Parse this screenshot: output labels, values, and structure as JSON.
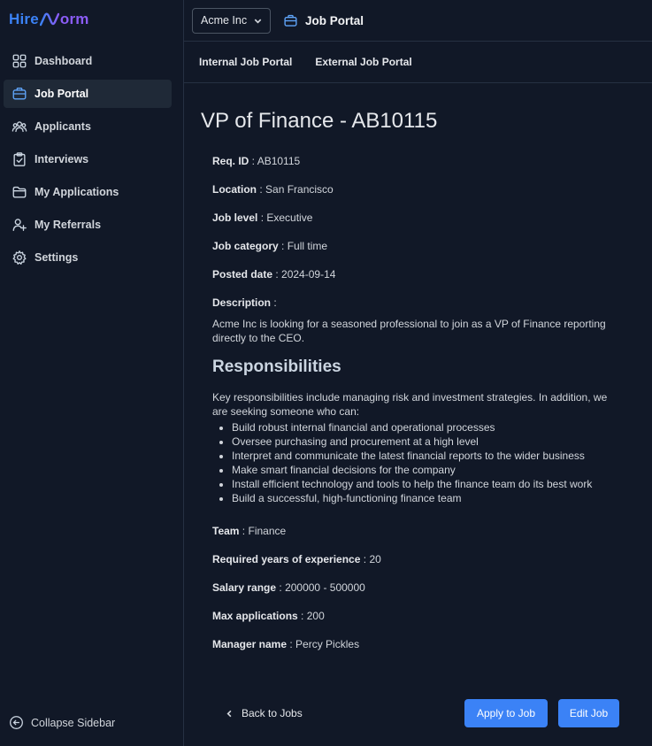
{
  "brand": {
    "logo_left": "Hire",
    "logo_right": "orm",
    "color_primary": "#3b82f6",
    "color_secondary": "#8b5cf6"
  },
  "sidebar": {
    "items": [
      {
        "label": "Dashboard",
        "icon": "grid-icon"
      },
      {
        "label": "Job Portal",
        "icon": "briefcase-icon",
        "active": true
      },
      {
        "label": "Applicants",
        "icon": "users-icon"
      },
      {
        "label": "Interviews",
        "icon": "clipboard-check-icon"
      },
      {
        "label": "My Applications",
        "icon": "folder-icon"
      },
      {
        "label": "My Referrals",
        "icon": "user-plus-icon"
      },
      {
        "label": "Settings",
        "icon": "gear-icon"
      }
    ],
    "collapse_label": "Collapse Sidebar"
  },
  "header": {
    "company": "Acme Inc",
    "title": "Job Portal"
  },
  "tabs": [
    {
      "label": "Internal Job Portal"
    },
    {
      "label": "External Job Portal"
    }
  ],
  "job": {
    "title": "VP of Finance - AB10115",
    "req_id_label": "Req. ID",
    "req_id": "AB10115",
    "location_label": "Location",
    "location": "San Francisco",
    "level_label": "Job level",
    "level": "Executive",
    "category_label": "Job category",
    "category": "Full time",
    "posted_label": "Posted date",
    "posted": "2024-09-14",
    "description_label": "Description",
    "description": "Acme Inc is looking for a seasoned professional to join as a VP of Finance reporting directly to the CEO.",
    "responsibilities_heading": "Responsibilities",
    "responsibilities_intro": "Key responsibilities include managing risk and investment strategies. In addition, we are seeking someone who can:",
    "responsibilities": [
      "Build robust internal financial and operational processes",
      "Oversee purchasing and procurement at a high level",
      "Interpret and communicate the latest financial reports to the wider business",
      "Make smart financial decisions for the company",
      "Install efficient technology and tools to help the finance team do its best work",
      "Build a successful, high-functioning finance team"
    ],
    "team_label": "Team",
    "team": "Finance",
    "experience_label": "Required years of experience",
    "experience": "20",
    "salary_label": "Salary range",
    "salary": "200000 - 500000",
    "max_apps_label": "Max applications",
    "max_apps": "200",
    "manager_label": "Manager name",
    "manager": "Percy Pickles"
  },
  "actions": {
    "back_label": "Back to Jobs",
    "apply_label": "Apply to Job",
    "edit_label": "Edit Job"
  }
}
